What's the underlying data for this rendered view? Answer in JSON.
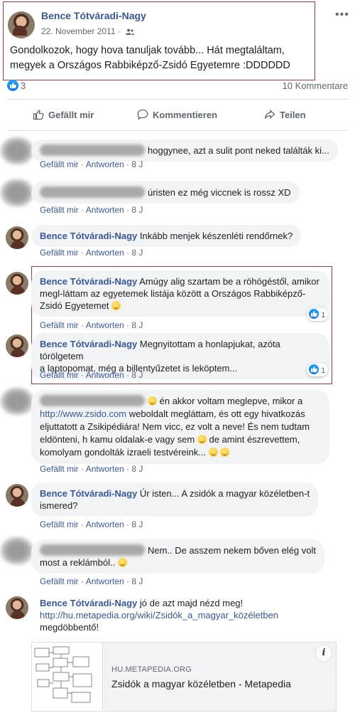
{
  "post": {
    "author": "Bence Tótváradi-Nagy",
    "date": "22. November 2011",
    "audience_icon": "friends-icon",
    "text": "Gondolkozok, hogy hova tanuljak tovább... Hát megtaláltam, megyek a Országos Rabbiképző-Zsidó Egyetemre :DDDDDD",
    "reaction_count": "3",
    "comment_count": "10 Kommentare"
  },
  "actions": {
    "like": "Gefällt mir",
    "comment": "Kommentieren",
    "share": "Teilen"
  },
  "comment_links": {
    "like": "Gefällt mir",
    "reply": "Antworten",
    "sep": "·"
  },
  "comments": [
    {
      "author_hidden": true,
      "text": "hoggynee, azt a sulit pont neked találták ki...",
      "time": "8 J"
    },
    {
      "author_hidden": true,
      "text": "úristen ez még viccnek is rossz XD",
      "time": "8 J"
    },
    {
      "author": "Bence Tótváradi-Nagy",
      "text": "Inkább menjek készenléti rendőrnek?",
      "time": "8 J"
    },
    {
      "author": "Bence Tótváradi-Nagy",
      "text": "Amúgy alig szartam be a röhögéstől, amikor megl-láttam az egyetemek listája között a Országos Rabbiképző-Zsidó Egyetemet",
      "time": "8 J",
      "reactions": "1"
    },
    {
      "author": "Bence Tótváradi-Nagy",
      "text_line1": "Megnyitottam a honlapjukat, azóta törölgetem",
      "text_line2": "a laptopomat, még a billentyűzetet is leköptem...",
      "time": "8 J",
      "reactions": "1"
    },
    {
      "author_hidden": true,
      "text_a": "én akkor voltam meglepve, mikor a",
      "link": "http://www.zsido.com",
      "text_b": "weboldalt megláttam, és ott egy hivatkozás",
      "text_c": "eljuttatott a Zsikipédiára! Nem vicc, ez volt a neve! És nem tudtam",
      "text_d": "eldönteni, h kamu oldalak-e vagy sem",
      "text_e": "de amint észrevettem,",
      "text_f": "komolyam gondolták izraeli testvéreink...",
      "time": "8 J"
    },
    {
      "author": "Bence Tótváradi-Nagy",
      "text_line1": "Úr isten... A zsidók a magyar közéletben-t",
      "text_line2": "ismered?",
      "time": "8 J"
    },
    {
      "author_hidden": true,
      "text_line1": "Nem.. De asszem nekem bőven elég volt",
      "text_line2": "most a reklámból..",
      "time": "8 J"
    },
    {
      "author": "Bence Tótváradi-Nagy",
      "text_a": "jó de azt majd nézd meg!",
      "link": "http://hu.metapedia.org/wiki/Zsidók_a_magyar_közéletben",
      "text_b": "megdöbbentő!"
    }
  ],
  "link_card": {
    "domain": "HU.METAPEDIA.ORG",
    "title": "Zsidók a magyar közéletben - Metapedia",
    "info_icon": "i"
  },
  "colors": {
    "name_blue": "#385898",
    "highlight_red": "#b8333d",
    "bubble_bg": "#f2f3f5",
    "like_blue": "#1877f2"
  }
}
